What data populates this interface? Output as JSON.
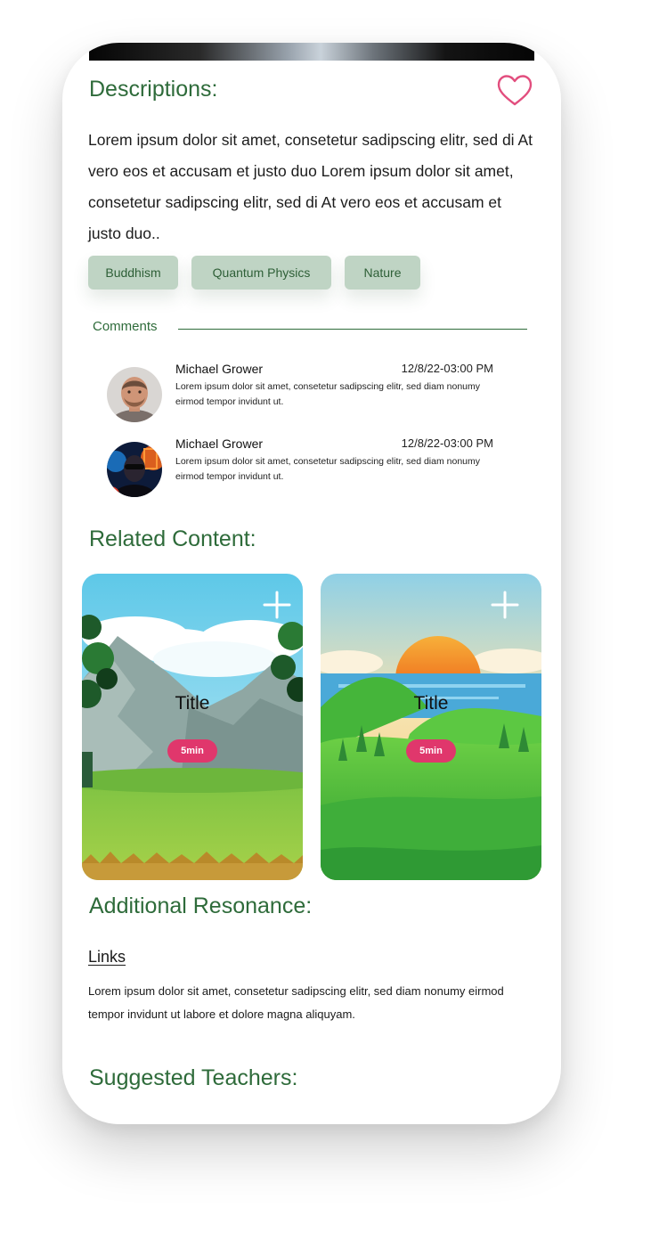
{
  "description": {
    "heading": "Descriptions:",
    "body": "Lorem ipsum dolor sit amet, consetetur sadipscing elitr, sed di At vero eos et accusam et justo duo Lorem ipsum dolor sit amet, consetetur sadipscing elitr, sed di At vero eos et accusam et justo duo..",
    "favorite_icon": "heart-outline-icon"
  },
  "tags": [
    "Buddhism",
    "Quantum Physics",
    "Nature"
  ],
  "comments": {
    "label": "Comments",
    "items": [
      {
        "name": "Michael Grower",
        "time": "12/8/22-03:00 PM",
        "text": "Lorem ipsum dolor sit amet, consetetur sadipscing elitr, sed diam nonumy eirmod tempor invidunt ut."
      },
      {
        "name": "Michael Grower",
        "time": "12/8/22-03:00 PM",
        "text": "Lorem ipsum dolor sit amet, consetetur sadipscing elitr, sed diam nonumy eirmod tempor invidunt ut."
      }
    ]
  },
  "related": {
    "heading": "Related Content:",
    "cards": [
      {
        "title": "Title",
        "duration": "5min",
        "add_icon": "plus-icon",
        "scene": "mountain-meadow"
      },
      {
        "title": "Title",
        "duration": "5min",
        "add_icon": "plus-icon",
        "scene": "sunset-lake-hills"
      }
    ]
  },
  "additional": {
    "heading": "Additional Resonance:",
    "link_label": "Links",
    "text": "Lorem ipsum dolor sit amet, consetetur sadipscing elitr, sed diam nonumy eirmod tempor invidunt ut labore et dolore magna aliquyam."
  },
  "teachers": {
    "heading": "Suggested Teachers:"
  },
  "colors": {
    "accent_green": "#2e6b3a",
    "tag_bg": "#bfd4c4",
    "badge_pink": "#e0376c",
    "heart_pink": "#e24e7e"
  }
}
